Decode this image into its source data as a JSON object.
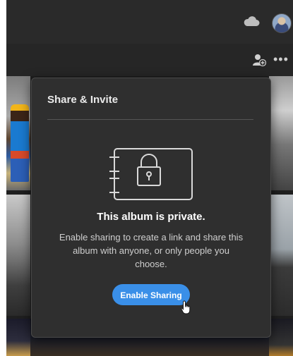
{
  "header": {
    "cloud_icon": "cloud-icon",
    "avatar_icon": "user-avatar"
  },
  "toolbar": {
    "add_person_icon": "add-person-icon",
    "more_label": "•••"
  },
  "dialog": {
    "title": "Share & Invite",
    "lock_icon": "locked-album-icon",
    "heading": "This album is private.",
    "description": "Enable sharing to create a link and share this album with anyone, or only people you choose.",
    "button_label": "Enable Sharing"
  },
  "colors": {
    "accent": "#3a8fe8",
    "panel_bg": "#2f2f2f",
    "app_bg": "#1f1f1f"
  }
}
